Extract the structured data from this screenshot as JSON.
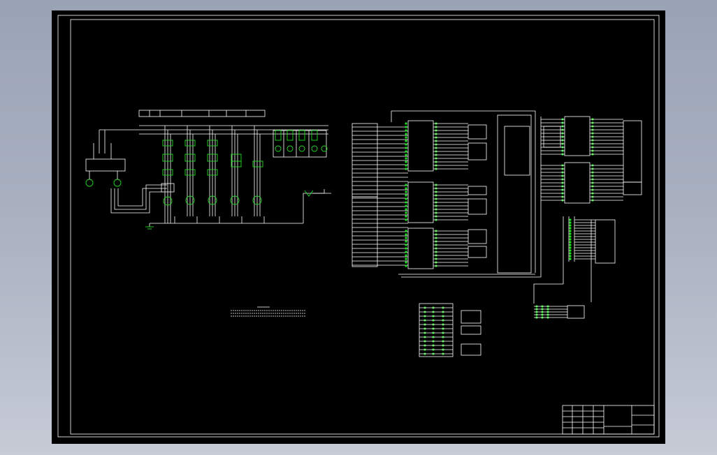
{
  "viewer": {
    "background_color": "#a6aebe",
    "canvas_color": "#000000",
    "line_color": "#ffffff",
    "symbol_color": "#22e022"
  },
  "drawing": {
    "notes_title": "",
    "title_block": {
      "drawing_title": "",
      "drawing_number": ""
    }
  }
}
